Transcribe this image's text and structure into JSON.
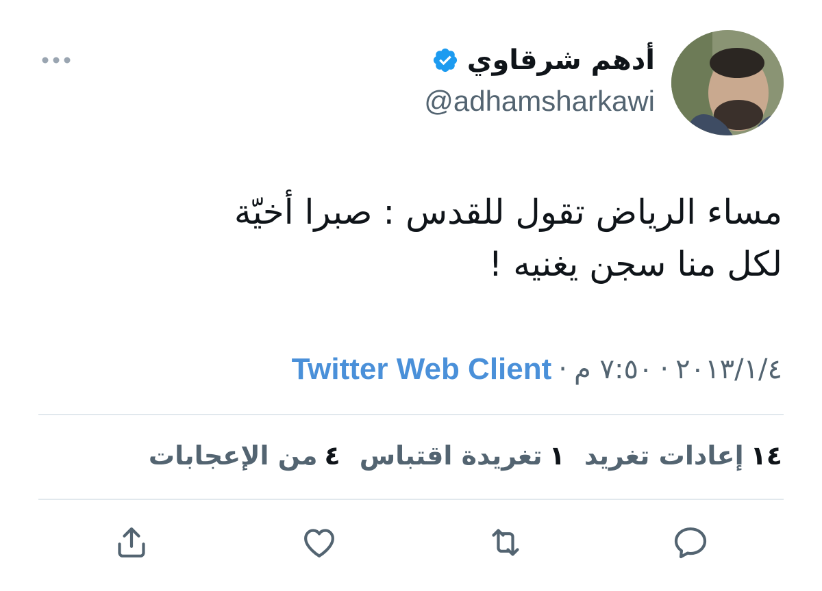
{
  "author": {
    "display_name": "أدهم شرقاوي",
    "handle": "@adhamsharkawi",
    "verified": true
  },
  "tweet": {
    "lines": [
      "مساء الرياض تقول للقدس : صبرا أخيّة",
      "لكل منا سجن يغنيه !"
    ]
  },
  "meta": {
    "date": "٢٠١٣/١/٤",
    "time": "٧:٥٠ م",
    "separator": "·",
    "source": "Twitter Web Client"
  },
  "stats": {
    "retweets": {
      "count": "١٤",
      "label": "إعادات تغريد"
    },
    "quotes": {
      "count": "١",
      "label": "تغريدة اقتباس"
    },
    "likes": {
      "count": "٤",
      "label": "من الإعجابات"
    }
  },
  "colors": {
    "link": "#4a90d9",
    "muted": "#536471",
    "verified": "#1d9bf0",
    "divider": "#e1e8ed"
  },
  "icons": {
    "more": "more-horizontal-icon",
    "verified": "verified-badge-icon",
    "reply": "reply-icon",
    "retweet": "retweet-icon",
    "like": "heart-icon",
    "share": "share-icon"
  }
}
